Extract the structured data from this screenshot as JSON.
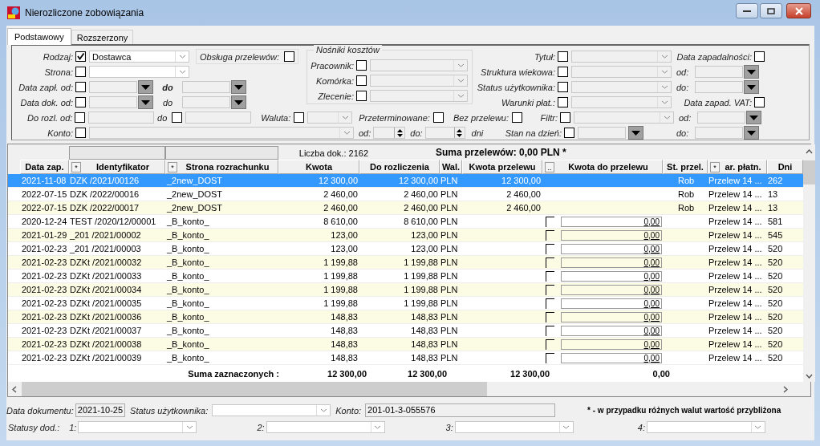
{
  "window": {
    "title": "Nierozliczone zobowiązania"
  },
  "tabs": [
    {
      "label": "Podstawowy",
      "selected": true
    },
    {
      "label": "Rozszerzony",
      "selected": false
    }
  ],
  "filters": {
    "left": [
      {
        "kind": "combo",
        "label": "Rodzaj:",
        "checked": true,
        "value": "Dostawca"
      },
      {
        "kind": "combo",
        "label": "Strona:",
        "checked": false
      },
      {
        "kind": "date_range",
        "label": "Data zapł. od:",
        "checked": false,
        "to_label": "do"
      },
      {
        "kind": "date_range",
        "label": "Data dok. od:",
        "checked": false,
        "to_label": "do"
      }
    ],
    "transfers": {
      "label": "Obsługa przelewów:",
      "checked": false
    },
    "cost_carriers": {
      "title": "Nośniki kosztów",
      "items": [
        {
          "label": "Pracownik:",
          "checked": false
        },
        {
          "label": "Komórka:",
          "checked": false
        },
        {
          "label": "Zlecenie:",
          "checked": false
        }
      ]
    },
    "to_settle": {
      "label": "Do rozl. od:",
      "checked": false,
      "to_label": "do",
      "to_checked": false
    },
    "currency": {
      "label": "Waluta:",
      "checked": false
    },
    "overdue": {
      "label": "Przeterminowane:",
      "checked": false
    },
    "no_transfer": {
      "label": "Bez przelewu:",
      "checked": false
    },
    "account": {
      "label": "Konto:",
      "checked": false
    },
    "days": {
      "from_label": "od:",
      "to_label": "do:",
      "unit": "dni"
    },
    "right": [
      {
        "label": "Tytuł:",
        "checked": false
      },
      {
        "label": "Struktura wiekowa:",
        "checked": false
      },
      {
        "label": "Status użytkownika:",
        "checked": false
      },
      {
        "label": "Warunki płat.:",
        "checked": false
      },
      {
        "label": "Filtr:",
        "checked": false
      }
    ],
    "as_of": {
      "label": "Stan na dzień:",
      "checked": false
    },
    "dates": [
      {
        "kind": "header",
        "label": "Data zapadalności:",
        "checked": false
      },
      {
        "kind": "date",
        "label": "od:"
      },
      {
        "kind": "date",
        "label": "do:"
      },
      {
        "kind": "header",
        "label": "Data zapad. VAT:",
        "checked": false
      },
      {
        "kind": "date",
        "label": "od:"
      },
      {
        "kind": "date",
        "label": "do:"
      }
    ]
  },
  "grid": {
    "doc_count": "Liczba dok.: 2162",
    "transfer_sum": "Suma przelewów: 0,00 PLN *",
    "columns": [
      {
        "label": "Data zap."
      },
      {
        "label": "Identyfikator",
        "button": "*"
      },
      {
        "label": "Strona rozrachunku",
        "button": "*"
      },
      {
        "label": "Kwota"
      },
      {
        "label": "Do rozliczenia"
      },
      {
        "label": "Wal."
      },
      {
        "label": "Kwota przelewu"
      },
      {
        "label": "Kwota do przelewu",
        "button": ".."
      },
      {
        "label": "St. przel."
      },
      {
        "label": "ar. płatn.",
        "button": "*"
      },
      {
        "label": "Dni"
      }
    ],
    "rows": [
      {
        "selected": true,
        "date": "2021-11-08",
        "id": "DZK /2021/00126",
        "party": "_2new_DOST",
        "amount": "12 300,00",
        "to_settle": "12 300,00",
        "currency": "PLN",
        "transfer_amount": "12 300,00",
        "status": "Rob",
        "method": "Przelew 14 ...",
        "days": "262"
      },
      {
        "selected": false,
        "date": "2022-07-15",
        "id": "DZK /2022/00016",
        "party": "_2new_DOST",
        "amount": "2 460,00",
        "to_settle": "2 460,00",
        "currency": "PLN",
        "transfer_amount": "2 460,00",
        "status": "Rob",
        "method": "Przelew 14 ...",
        "days": "13"
      },
      {
        "selected": false,
        "date": "2022-07-15",
        "id": "DZK /2022/00017",
        "party": "_2new_DOST",
        "amount": "2 460,00",
        "to_settle": "2 460,00",
        "currency": "PLN",
        "transfer_amount": "2 460,00",
        "status": "Rob",
        "method": "Przelew 14 ...",
        "days": "13"
      },
      {
        "selected": false,
        "date": "2020-12-24",
        "id": "TEST /2020/12/00001",
        "party": "_B_konto_",
        "amount": "8 610,00",
        "to_settle": "8 610,00",
        "currency": "PLN",
        "transfer": {
          "checked": false,
          "value": "0,00"
        },
        "method": "Przelew 14 ...",
        "days": "581"
      },
      {
        "selected": false,
        "date": "2021-01-29",
        "id": "_201 /2021/00002",
        "party": "_B_konto_",
        "amount": "123,00",
        "to_settle": "123,00",
        "currency": "PLN",
        "transfer": {
          "checked": false,
          "value": "0,00"
        },
        "method": "Przelew 14 ...",
        "days": "545"
      },
      {
        "selected": false,
        "date": "2021-02-23",
        "id": "_201 /2021/00003",
        "party": "_B_konto_",
        "amount": "123,00",
        "to_settle": "123,00",
        "currency": "PLN",
        "transfer": {
          "checked": false,
          "value": "0,00"
        },
        "method": "Przelew 14 ...",
        "days": "520"
      },
      {
        "selected": false,
        "date": "2021-02-23",
        "id": "DZKt /2021/00032",
        "party": "_B_konto_",
        "amount": "1 199,88",
        "to_settle": "1 199,88",
        "currency": "PLN",
        "transfer": {
          "checked": false,
          "value": "0,00"
        },
        "method": "Przelew 14 ...",
        "days": "520"
      },
      {
        "selected": false,
        "date": "2021-02-23",
        "id": "DZKt /2021/00033",
        "party": "_B_konto_",
        "amount": "1 199,88",
        "to_settle": "1 199,88",
        "currency": "PLN",
        "transfer": {
          "checked": false,
          "value": "0,00"
        },
        "method": "Przelew 14 ...",
        "days": "520"
      },
      {
        "selected": false,
        "date": "2021-02-23",
        "id": "DZKt /2021/00034",
        "party": "_B_konto_",
        "amount": "1 199,88",
        "to_settle": "1 199,88",
        "currency": "PLN",
        "transfer": {
          "checked": false,
          "value": "0,00"
        },
        "method": "Przelew 14 ...",
        "days": "520"
      },
      {
        "selected": false,
        "date": "2021-02-23",
        "id": "DZKt /2021/00035",
        "party": "_B_konto_",
        "amount": "1 199,88",
        "to_settle": "1 199,88",
        "currency": "PLN",
        "transfer": {
          "checked": false,
          "value": "0,00"
        },
        "method": "Przelew 14 ...",
        "days": "520"
      },
      {
        "selected": false,
        "date": "2021-02-23",
        "id": "DZKt /2021/00036",
        "party": "_B_konto_",
        "amount": "148,83",
        "to_settle": "148,83",
        "currency": "PLN",
        "transfer": {
          "checked": false,
          "value": "0,00"
        },
        "method": "Przelew 14 ...",
        "days": "520"
      },
      {
        "selected": false,
        "date": "2021-02-23",
        "id": "DZKt /2021/00037",
        "party": "_B_konto_",
        "amount": "148,83",
        "to_settle": "148,83",
        "currency": "PLN",
        "transfer": {
          "checked": false,
          "value": "0,00"
        },
        "method": "Przelew 14 ...",
        "days": "520"
      },
      {
        "selected": false,
        "date": "2021-02-23",
        "id": "DZKt /2021/00038",
        "party": "_B_konto_",
        "amount": "148,83",
        "to_settle": "148,83",
        "currency": "PLN",
        "transfer": {
          "checked": false,
          "value": "0,00"
        },
        "method": "Przelew 14 ...",
        "days": "520"
      },
      {
        "selected": false,
        "date": "2021-02-23",
        "id": "DZKt /2021/00039",
        "party": "_B_konto_",
        "amount": "148,83",
        "to_settle": "148,83",
        "currency": "PLN",
        "transfer": {
          "checked": false,
          "value": "0,00"
        },
        "method": "Przelew 14 ...",
        "days": "520"
      }
    ],
    "summary": {
      "label": "Suma zaznaczonych :",
      "amount": "12 300,00",
      "to_settle": "12 300,00",
      "transfer_amount": "12 300,00",
      "to_transfer": "0,00"
    }
  },
  "footer": {
    "doc_date": {
      "label": "Data dokumentu:",
      "value": "2021-10-25"
    },
    "user_status": {
      "label": "Status użytkownika:"
    },
    "account": {
      "label": "Konto:",
      "value": "201-01-3-055576"
    },
    "note": "* - w przypadku różnych walut wartość przybliżona",
    "extra_label": "Statusy dod.:",
    "extra": [
      {
        "label": "1:"
      },
      {
        "label": "2:"
      },
      {
        "label": "3:"
      },
      {
        "label": "4:"
      }
    ]
  }
}
